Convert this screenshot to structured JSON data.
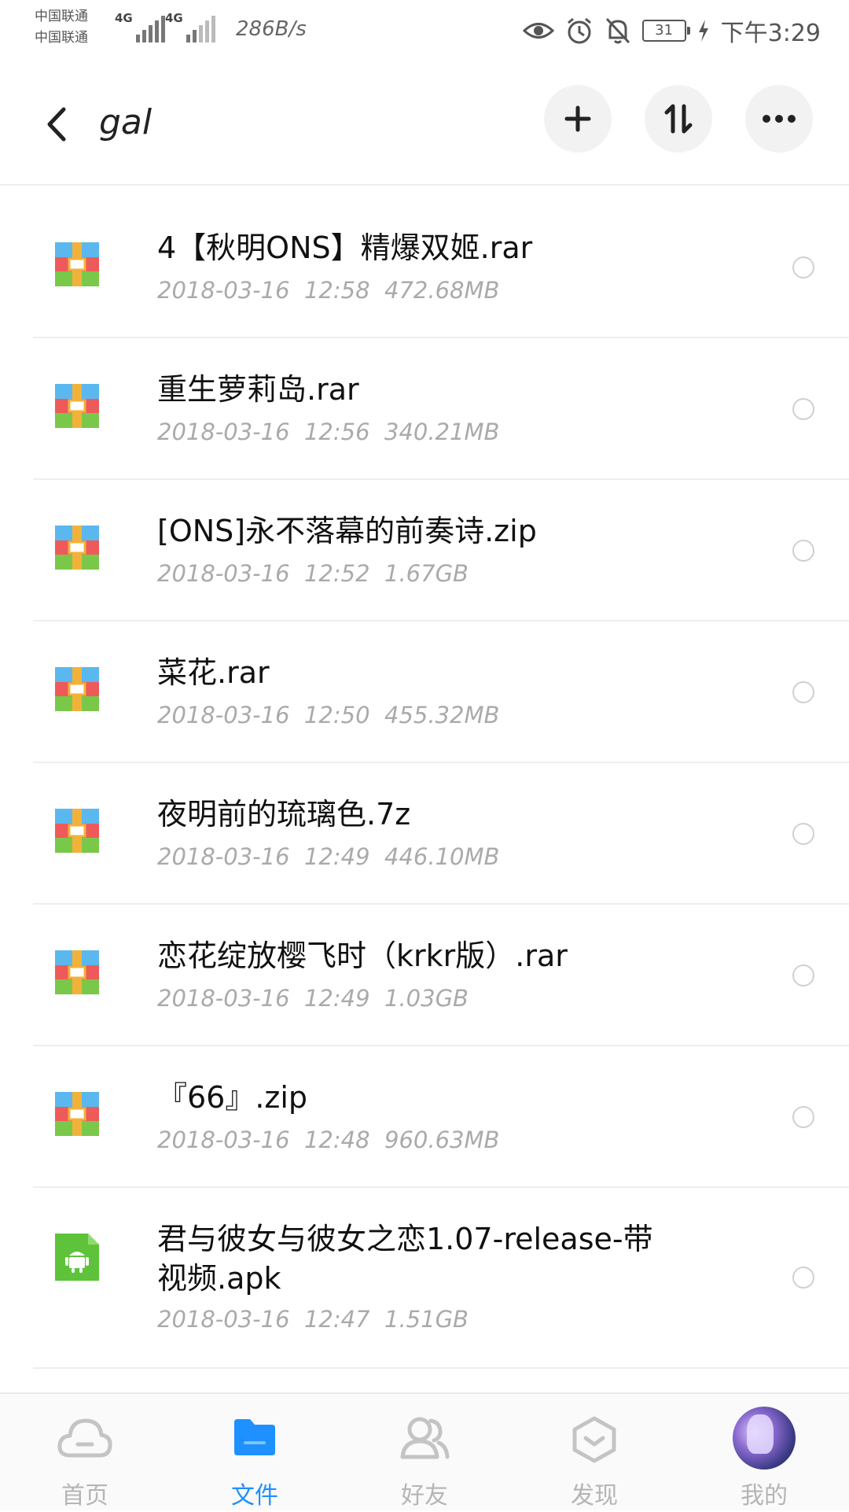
{
  "status_bar": {
    "carrier_1": "中国联通",
    "carrier_2": "中国联通",
    "net_type_1": "4G",
    "net_type_2": "4G",
    "net_speed": "286B/s",
    "battery": "31",
    "time": "下午3:29"
  },
  "header": {
    "title": "gal",
    "back_icon": "chevron-left-icon",
    "add_icon": "plus-icon",
    "sort_icon": "sort-icon",
    "more_icon": "more-icon"
  },
  "files": [
    {
      "name": "4【秋明ONS】精爆双姬.rar",
      "date": "2018-03-16",
      "time": "12:58",
      "size": "472.68MB",
      "type": "archive"
    },
    {
      "name": "重生萝莉岛.rar",
      "date": "2018-03-16",
      "time": "12:56",
      "size": "340.21MB",
      "type": "archive"
    },
    {
      "name": "[ONS]永不落幕的前奏诗.zip",
      "date": "2018-03-16",
      "time": "12:52",
      "size": "1.67GB",
      "type": "archive"
    },
    {
      "name": "菜花.rar",
      "date": "2018-03-16",
      "time": "12:50",
      "size": "455.32MB",
      "type": "archive"
    },
    {
      "name": "夜明前的琉璃色.7z",
      "date": "2018-03-16",
      "time": "12:49",
      "size": "446.10MB",
      "type": "archive"
    },
    {
      "name": "恋花绽放樱飞时（krkr版）.rar",
      "date": "2018-03-16",
      "time": "12:49",
      "size": "1.03GB",
      "type": "archive"
    },
    {
      "name": "『66』.zip",
      "date": "2018-03-16",
      "time": "12:48",
      "size": "960.63MB",
      "type": "archive"
    },
    {
      "name": "君与彼女与彼女之恋1.07-release-带视频.apk",
      "date": "2018-03-16",
      "time": "12:47",
      "size": "1.51GB",
      "type": "apk"
    }
  ],
  "bottom_nav": {
    "items": [
      {
        "label": "首页",
        "icon": "cloud-icon",
        "active": false
      },
      {
        "label": "文件",
        "icon": "folder-icon",
        "active": true
      },
      {
        "label": "好友",
        "icon": "friends-icon",
        "active": false
      },
      {
        "label": "发现",
        "icon": "discover-icon",
        "active": false
      },
      {
        "label": "我的",
        "icon": "avatar",
        "active": false
      }
    ]
  },
  "colors": {
    "accent": "#1e90ff",
    "apk_green": "#5ec33a",
    "divider": "#eeeeee",
    "meta_text": "#aaaaaa"
  }
}
